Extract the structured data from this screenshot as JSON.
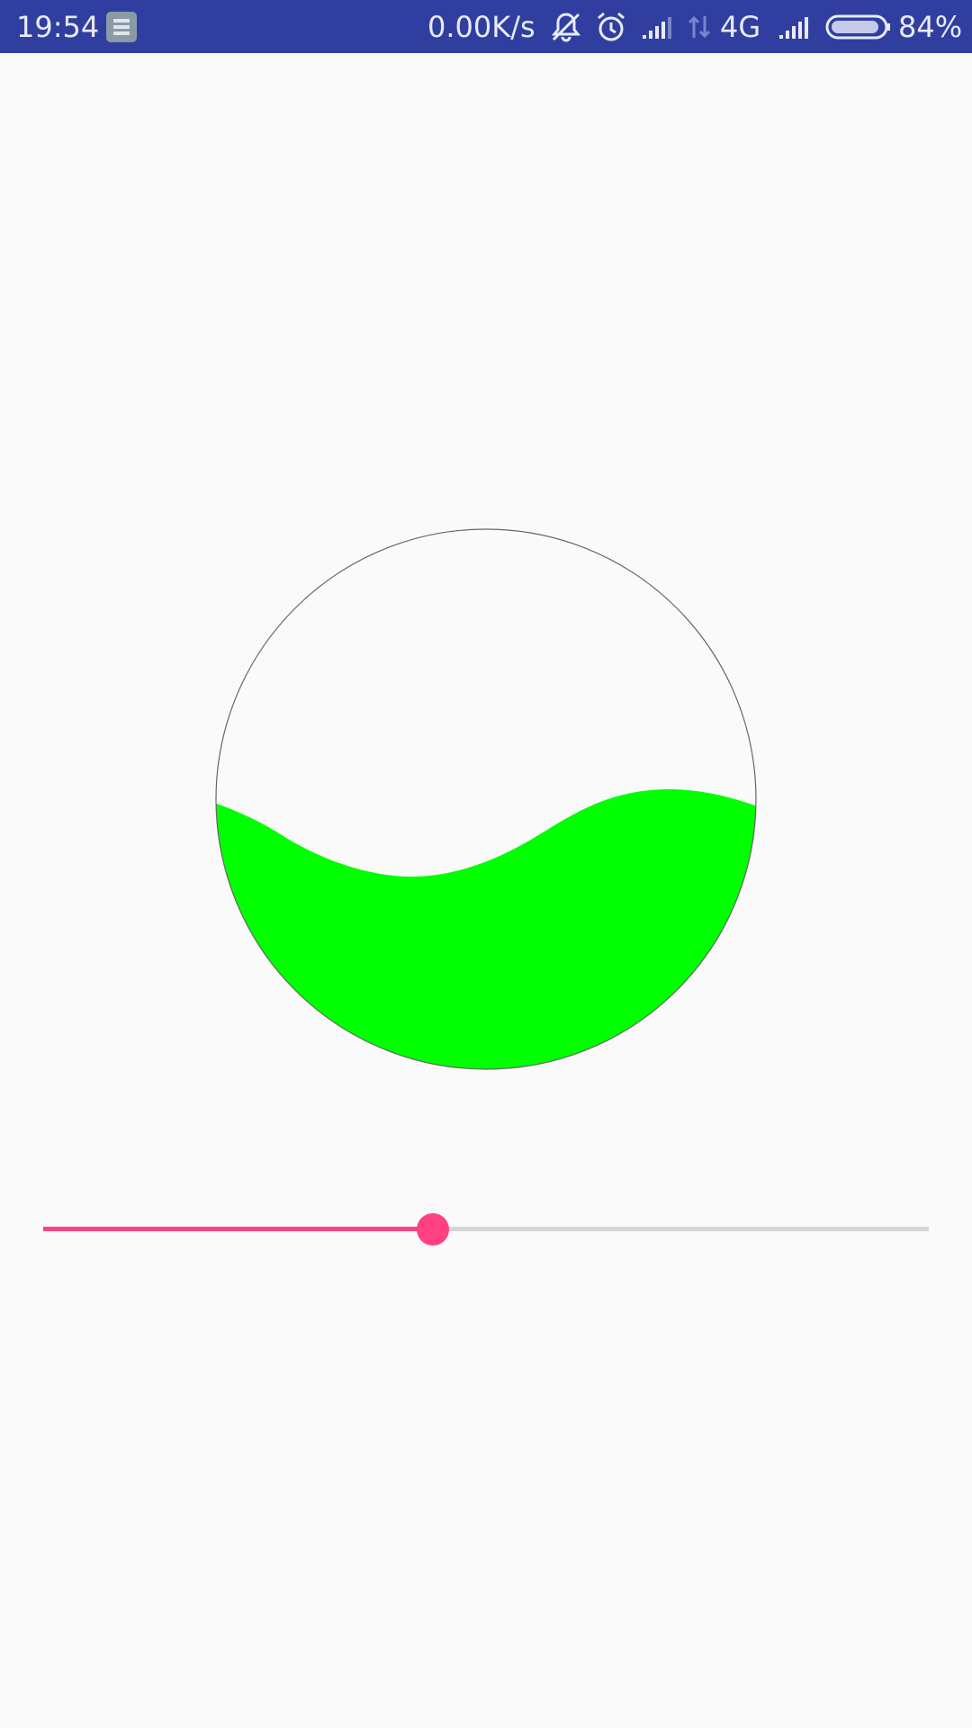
{
  "status_bar": {
    "time": "19:54",
    "net_speed": "0.00K/s",
    "network_type": "4G",
    "battery_percent": "84%",
    "background_color": "#303f9f",
    "icons": [
      "app-notification-icon",
      "silent-mode-icon",
      "alarm-icon",
      "signal-icon",
      "data-transfer-icon",
      "signal-icon",
      "battery-icon"
    ]
  },
  "wave_view": {
    "fill_color": "#00ff00",
    "outline_color": "#666666",
    "fill_level": 0.5
  },
  "seekbar": {
    "progress": 0.44,
    "progress_color": "#ff4081",
    "track_color": "#d6d6d6"
  }
}
